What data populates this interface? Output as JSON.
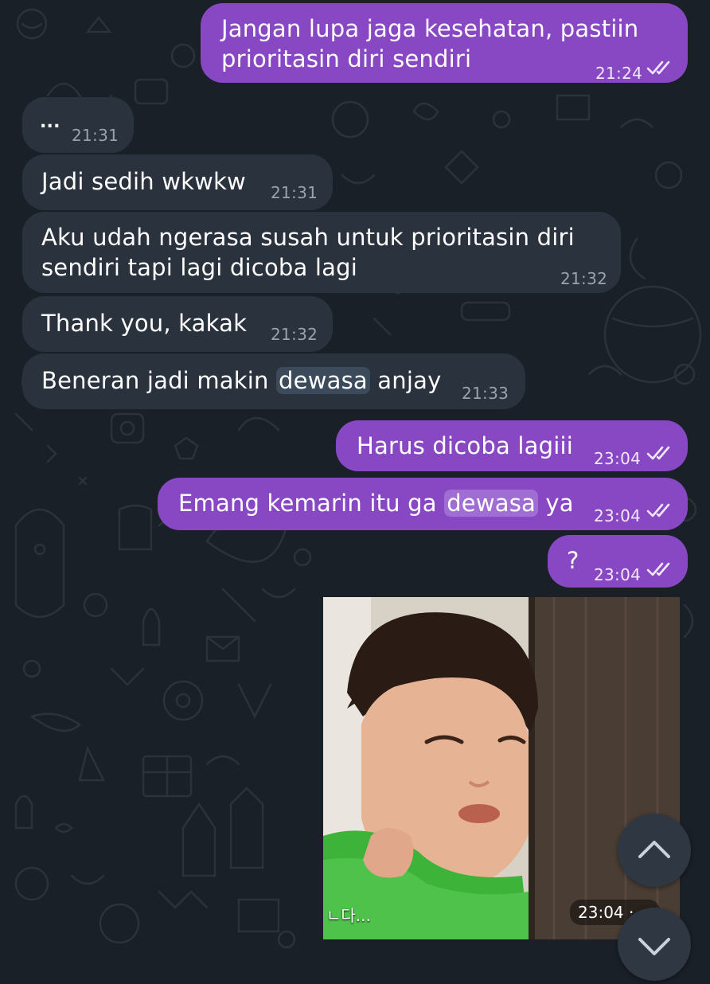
{
  "messages": [
    {
      "dir": "out",
      "text_line1": "Jangan lupa jaga kesehatan, pastiin",
      "text_line2": "prioritasin diri sendiri",
      "time": "21:24"
    },
    {
      "dir": "in",
      "text": "...",
      "time": "21:31"
    },
    {
      "dir": "in",
      "text": "Jadi sedih wkwkw",
      "time": "21:31"
    },
    {
      "dir": "in",
      "text_line1": "Aku udah ngerasa susah untuk prioritasin diri",
      "text_line2": "sendiri tapi lagi dicoba lagi",
      "time": "21:32"
    },
    {
      "dir": "in",
      "text": "Thank you, kakak",
      "time": "21:32"
    },
    {
      "dir": "in",
      "text_before": "Beneran jadi makin ",
      "highlight": "dewasa",
      "text_after": " anjay",
      "time": "21:33"
    },
    {
      "dir": "out",
      "text": "Harus dicoba lagiii",
      "time": "23:04"
    },
    {
      "dir": "out",
      "text_before": "Emang kemarin itu ga ",
      "highlight": "dewasa",
      "text_after": " ya",
      "time": "23:04"
    },
    {
      "dir": "out",
      "text": "?",
      "time": "23:04"
    }
  ],
  "sticker": {
    "caption": "ㄴ다...",
    "time": "23:04 · ‹‹"
  },
  "colors": {
    "background": "#1a2027",
    "incoming": "#2a333d",
    "outgoing": "#8848c4",
    "accent": "#a06dd3"
  },
  "icons": {
    "scroll_up": "chevron-up-icon",
    "scroll_down": "chevron-down-icon",
    "read": "double-check-icon"
  }
}
